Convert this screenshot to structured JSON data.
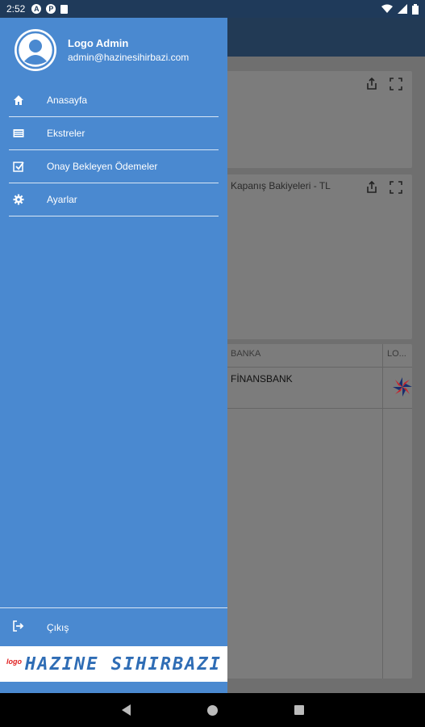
{
  "status_bar": {
    "time": "2:52",
    "icons": [
      "a-circle-icon",
      "p-circle-icon",
      "sd-card-icon",
      "wifi-icon",
      "signal-icon",
      "battery-icon"
    ]
  },
  "drawer": {
    "user": {
      "name": "Logo Admin",
      "email": "admin@hazinesihirbazi.com"
    },
    "menu": [
      {
        "label": "Anasayfa",
        "icon": "home-icon"
      },
      {
        "label": "Ekstreler",
        "icon": "statement-icon"
      },
      {
        "label": "Onay Bekleyen Ödemeler",
        "icon": "check-square-icon"
      },
      {
        "label": "Ayarlar",
        "icon": "gear-icon"
      }
    ],
    "logout_label": "Çıkış",
    "brand": {
      "small": "logo",
      "main": "HAZINE SIHIRBAZI"
    }
  },
  "background": {
    "card2_title": "Kapanış Bakiyeleri - TL",
    "table": {
      "col1": "BANKA",
      "col2": "LO...",
      "row1_bank": "FİNANSBANK"
    }
  },
  "colors": {
    "drawer": "#4a89d0",
    "appbar": "#223a55",
    "brand_blue": "#2f6db5",
    "brand_red": "#e02020"
  }
}
